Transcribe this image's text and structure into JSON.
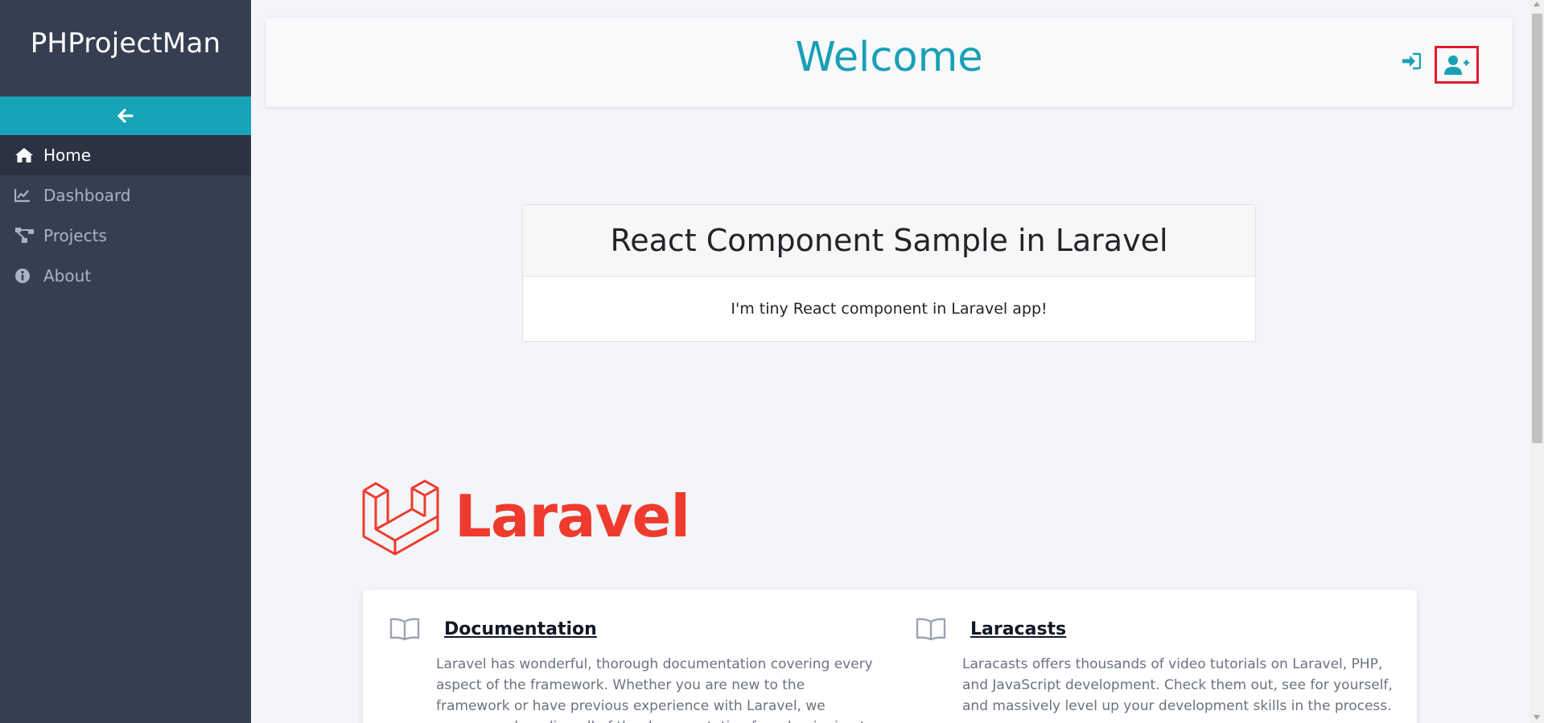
{
  "sidebar": {
    "brand": "PHProjectMan",
    "collapse_icon": "arrow-left-icon",
    "items": [
      {
        "label": "Home",
        "icon": "home-icon",
        "active": true
      },
      {
        "label": "Dashboard",
        "icon": "chart-line-icon",
        "active": false
      },
      {
        "label": "Projects",
        "icon": "project-diagram-icon",
        "active": false
      },
      {
        "label": "About",
        "icon": "info-circle-icon",
        "active": false
      }
    ]
  },
  "header": {
    "title": "Welcome",
    "login_icon": "sign-in-icon",
    "register_icon": "user-plus-icon"
  },
  "react_card": {
    "title": "React Component Sample in Laravel",
    "body": "I'm tiny React component in Laravel app!"
  },
  "laravel": {
    "logo_text": "Laravel",
    "links": [
      {
        "title": "Documentation",
        "icon": "book-icon",
        "text": "Laravel has wonderful, thorough documentation covering every aspect of the framework. Whether you are new to the framework or have previous experience with Laravel, we recommend reading all of the documentation from beginning to end."
      },
      {
        "title": "Laracasts",
        "icon": "book-icon",
        "text": "Laracasts offers thousands of video tutorials on Laravel, PHP, and JavaScript development. Check them out, see for yourself, and massively level up your development skills in the process."
      }
    ]
  },
  "colors": {
    "sidebar_bg": "#363f51",
    "accent_teal": "#17a3b8",
    "laravel_red": "#ef3b2d",
    "highlight_red": "#e01b2c"
  }
}
